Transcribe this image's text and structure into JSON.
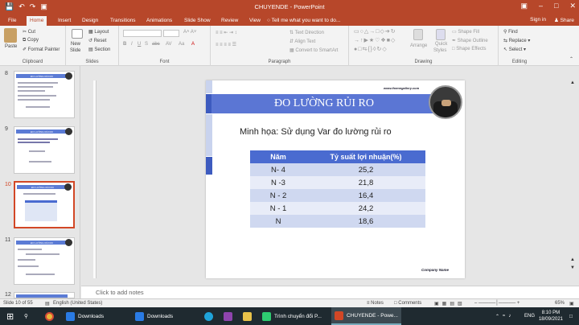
{
  "window": {
    "title": "CHUYENDE - PowerPoint",
    "signin": "Sign in",
    "share": "Share",
    "tell_me": "Tell me what you want to do..."
  },
  "tabs": [
    "File",
    "Home",
    "Insert",
    "Design",
    "Transitions",
    "Animations",
    "Slide Show",
    "Review",
    "View"
  ],
  "ribbon": {
    "clipboard": {
      "label": "Clipboard",
      "paste": "Paste",
      "cut": "Cut",
      "copy": "Copy",
      "format_painter": "Format Painter"
    },
    "slides": {
      "label": "Slides",
      "new_slide": "New",
      "new_slide2": "Slide",
      "layout": "Layout",
      "reset": "Reset",
      "section": "Section"
    },
    "font": {
      "label": "Font"
    },
    "paragraph": {
      "label": "Paragraph",
      "text_direction": "Text Direction",
      "align_text": "Align Text",
      "convert": "Convert to SmartArt"
    },
    "drawing": {
      "label": "Drawing",
      "arrange": "Arrange",
      "quick_styles": "Quick",
      "quick_styles2": "Styles",
      "shape_fill": "Shape Fill",
      "shape_outline": "Shape Outline",
      "shape_effects": "Shape Effects"
    },
    "editing": {
      "label": "Editing",
      "find": "Find",
      "replace": "Replace",
      "select": "Select"
    }
  },
  "thumbnails": [
    {
      "num": "8",
      "title": "ĐO LƯỜNG RỦI RO"
    },
    {
      "num": "9",
      "title": "ĐO LƯỜNG RỦI RO"
    },
    {
      "num": "10",
      "title": "ĐO LƯỜNG RỦI RO"
    },
    {
      "num": "11",
      "title": "ĐO LƯỜNG RỦI RO"
    },
    {
      "num": "12",
      "title": ""
    }
  ],
  "slide": {
    "title": "ĐO LƯỜNG RỦI RO",
    "website": "www.themegallery.com",
    "subtitle": "Minh họa: Sử dụng Var đo lường rủi ro",
    "table": {
      "headers": [
        "Năm",
        "Tỷ suất lợi nhuận(%)"
      ],
      "rows": [
        [
          "N- 4",
          "25,2"
        ],
        [
          "N -3",
          "21,8"
        ],
        [
          "N - 2",
          "16,4"
        ],
        [
          "N - 1",
          "24,2"
        ],
        [
          "N",
          "18,6"
        ]
      ]
    },
    "company": "Company Name"
  },
  "notes_placeholder": "Click to add notes",
  "status": {
    "slide_of": "Slide 10 of 55",
    "language": "English (United States)",
    "notes": "Notes",
    "comments": "Comments",
    "zoom": "65%"
  },
  "taskbar": {
    "items": [
      "Downloads",
      "Downloads",
      "Trình chuyển đổi P...",
      "CHUYENDE - Powe..."
    ],
    "lang": "ENG",
    "time": "8:10 PM",
    "date": "18/09/2021"
  },
  "colors": {
    "accent": "#b7472a",
    "slide_blue": "#5b76d4",
    "table_header": "#4a6bd0"
  }
}
